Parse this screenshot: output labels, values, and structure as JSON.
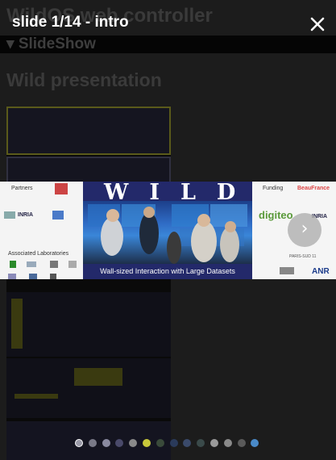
{
  "page": {
    "title": "WildOS web controller",
    "section": "▾ SlideShow",
    "heading": "Wild presentation"
  },
  "overlay": {
    "slide_title": "slide 1/14 - intro",
    "close_icon": "close-icon",
    "next_icon": "chevron-right-icon"
  },
  "slide": {
    "partners_label": "Partners",
    "associated_label": "Associated Laboratories",
    "funding_label": "Funding",
    "wild_title": "WILD",
    "caption": "Wall-sized Interaction with Large Datasets",
    "beau_france": "BeauFrance",
    "digiteo": "digiteo",
    "inria": "INRIA",
    "anr": "ANR",
    "paris_sud": "PARIS-SUD 11"
  },
  "pager": {
    "total": 14,
    "current_index": 0,
    "dot_colors": [
      "#9a9aa8",
      "#7a7a88",
      "#8a8aa0",
      "#4a4a6a",
      "#8a8a8a",
      "#c8c83a",
      "#3a4a3a",
      "#2a3a5a",
      "#3a4a6a",
      "#3a4a4a",
      "#9a9a9a",
      "#8a8a8a",
      "#5a5a5a",
      "#4a8ac8"
    ]
  }
}
